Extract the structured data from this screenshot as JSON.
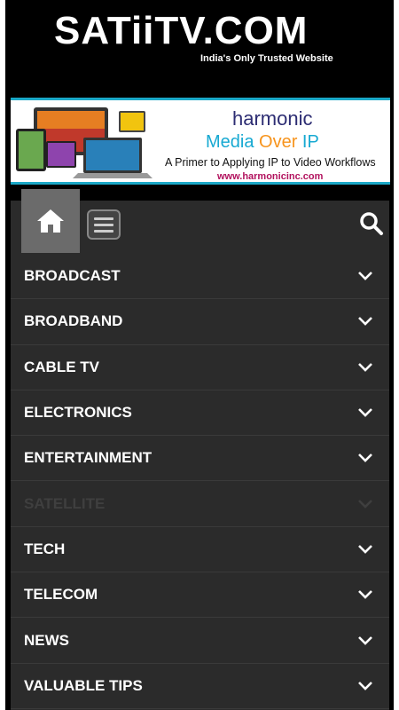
{
  "site": {
    "logo_text": "SATiiTV.COM",
    "tagline": "India's Only Trusted Website"
  },
  "banner": {
    "brand": "harmonic",
    "headline_part1": "Media ",
    "headline_over": "Over",
    "headline_part2": " IP",
    "subtitle": "A Primer to Applying IP to Video Workflows",
    "url": "www.harmonicinc.com"
  },
  "nav": {
    "home_icon": "home-icon",
    "menu_icon": "hamburger-icon",
    "search_icon": "search-icon",
    "items": [
      {
        "label": "BROADCAST"
      },
      {
        "label": "BROADBAND"
      },
      {
        "label": "CABLE TV"
      },
      {
        "label": "ELECTRONICS"
      },
      {
        "label": "ENTERTAINMENT"
      },
      {
        "label": "SATELLITE"
      },
      {
        "label": "TECH"
      },
      {
        "label": "TELECOM"
      },
      {
        "label": "NEWS"
      },
      {
        "label": "VALUABLE TIPS"
      }
    ]
  },
  "colors": {
    "background": "#000000",
    "nav_bg": "#2b2b2b",
    "home_btn_bg": "#6b6b6b",
    "banner_accent": "#17a9d2",
    "banner_brand": "#2d2d73",
    "banner_url": "#b2125e"
  }
}
